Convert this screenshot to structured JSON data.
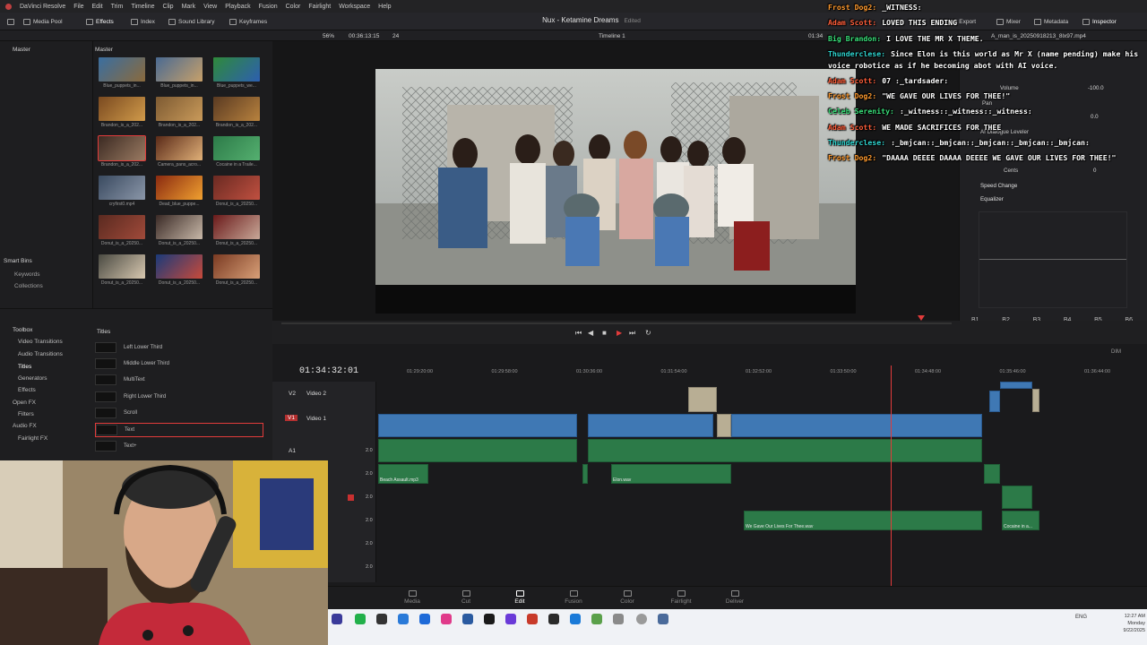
{
  "app": {
    "name": "DaVinci Resolve",
    "menu": [
      "File",
      "Edit",
      "Trim",
      "Timeline",
      "Clip",
      "Mark",
      "View",
      "Playback",
      "Fusion",
      "Color",
      "Fairlight",
      "Workspace",
      "Help"
    ],
    "project_title": "Nux - Ketamine Dreams",
    "project_state": "Edited"
  },
  "toolbar": {
    "media_pool": "Media Pool",
    "effects": "Effects",
    "index": "Index",
    "sound_library": "Sound Library",
    "keyframes": "Keyframes",
    "quick_export": "ck Export",
    "mixer": "Mixer",
    "metadata": "Metadata",
    "inspector": "Inspector"
  },
  "subbar": {
    "zoom": "56%",
    "timecode": "00:36:13:15",
    "frames": "24",
    "timeline_name": "Timeline 1",
    "viewer_tc": "01:34",
    "clip_file": "A_man_is_20250918213_8lx97.mp4"
  },
  "bins": {
    "master_left": "Master",
    "master_right": "Master",
    "smart_bins": "Smart Bins",
    "keywords": "Keywords",
    "collections": "Collections"
  },
  "thumbs": [
    {
      "label": "Blue_puppets_in...",
      "c1": "#3a6ea0",
      "c2": "#8a6a3c"
    },
    {
      "label": "Blue_puppets_in...",
      "c1": "#4a6a92",
      "c2": "#c7a06a"
    },
    {
      "label": "Blue_puppets_we...",
      "c1": "#2f8a3a",
      "c2": "#2d5fb0"
    },
    {
      "label": "Brandon_is_a_202...",
      "c1": "#7a4a20",
      "c2": "#d09a4a"
    },
    {
      "label": "Brandon_is_a_202...",
      "c1": "#7d5a32",
      "c2": "#c99a5a"
    },
    {
      "label": "Brandon_is_a_202...",
      "c1": "#5a3a22",
      "c2": "#b8823e"
    },
    {
      "label": "Brandon_is_a_202...",
      "c1": "#3b2a22",
      "c2": "#9a7a62"
    },
    {
      "label": "Camera_pans_acro...",
      "c1": "#5a2a18",
      "c2": "#e0b078"
    },
    {
      "label": "Cocaine in a Traile...",
      "c1": "#2c7a48",
      "c2": "#55b070"
    },
    {
      "label": "cryfirst0.mp4",
      "c1": "#3a4a60",
      "c2": "#8a96a8"
    },
    {
      "label": "Dead_blue_puppe...",
      "c1": "#8a2a10",
      "c2": "#f0a030"
    },
    {
      "label": "Donut_is_a_20250...",
      "c1": "#6a2a22",
      "c2": "#c05040"
    },
    {
      "label": "Donut_is_a_20250...",
      "c1": "#5a2a20",
      "c2": "#a04a3a"
    },
    {
      "label": "Donut_is_a_20250...",
      "c1": "#3a2a26",
      "c2": "#c8b8a8"
    },
    {
      "label": "Donut_is_a_20250...",
      "c1": "#6a1a1a",
      "c2": "#c8a898"
    },
    {
      "label": "Donut_is_a_20250...",
      "c1": "#4a4a42",
      "c2": "#d8c8b0"
    },
    {
      "label": "Donut_is_a_20250...",
      "c1": "#1a3a7a",
      "c2": "#c84a3a"
    },
    {
      "label": "Donut_is_a_20250...",
      "c1": "#7a3a22",
      "c2": "#d8a078"
    }
  ],
  "toolbox": {
    "items": [
      "Toolbox",
      "Video Transitions",
      "Audio Transitions",
      "Titles",
      "Generators",
      "Effects",
      "Open FX",
      "Filters",
      "Audio FX",
      "Fairlight FX"
    ],
    "header": "Titles",
    "titles": [
      "Left Lower Third",
      "Middle Lower Third",
      "MultiText",
      "Right Lower Third",
      "Scroll",
      "Text",
      "Text+"
    ]
  },
  "inspector": {
    "volume_label": "Volume",
    "volume_val": "-100.0",
    "pan_label": "Pan",
    "pan_val": "0.0",
    "dialogue": "AI Dialogue Leveler",
    "cents_label": "Cents",
    "cents_val": "0",
    "speed_change": "Speed Change",
    "equalizer": "Equalizer",
    "eq_bands": [
      "B1",
      "B2",
      "B3",
      "B4",
      "B5",
      "B6"
    ]
  },
  "timeline": {
    "timecode": "01:34:32:01",
    "ruler": [
      "01:29:20:00",
      "01:29:58:00",
      "01:30:36:00",
      "01:31:54:00",
      "01:32:52:00",
      "01:33:50:00",
      "01:34:48:00",
      "01:35:46:00",
      "01:36:44:00"
    ],
    "tracks": [
      {
        "id": "V2",
        "name": "Video 2"
      },
      {
        "id": "V1",
        "name": "Video 1"
      },
      {
        "id": "A1",
        "name": "",
        "level": "2.0"
      },
      {
        "id": "",
        "name": "",
        "level": "2.0"
      },
      {
        "id": "",
        "name": "",
        "level": "2.0"
      },
      {
        "id": "",
        "name": "",
        "level": "2.0"
      },
      {
        "id": "",
        "name": "",
        "level": "2.0"
      },
      {
        "id": "",
        "name": "",
        "level": "2.0"
      }
    ],
    "clip_labels": {
      "beach": "Beach Assault.mp3",
      "elon": "Elon.wav",
      "gave": "We Gave Our Lives For Thee.wav",
      "cocaine": "Cocaine in a..."
    },
    "dim_label": "DIM"
  },
  "pages": [
    "Media",
    "Cut",
    "Edit",
    "Fusion",
    "Color",
    "Fairlight",
    "Deliver"
  ],
  "active_page": "Edit",
  "chat": [
    {
      "user": "Frost Dog2:",
      "color": "#ff9a2e",
      "msg": "_WITNESS:"
    },
    {
      "user": "Adam Scott:",
      "color": "#ff5e3a",
      "msg": "LOVED THIS ENDING"
    },
    {
      "user": "Big Brandon:",
      "color": "#39e07a",
      "msg": "I LOVE THE MR X THEME."
    },
    {
      "user": "Thunderclese:",
      "color": "#2ed5d0",
      "msg": "Since Elon is this world as Mr X (name pending) make his voice robotice as if he becoming abot with AI voice."
    },
    {
      "user": "Adam Scott:",
      "color": "#ff5e3a",
      "msg": "07 :_tardsader:"
    },
    {
      "user": "Frost Dog2:",
      "color": "#ff9a2e",
      "msg": "\"WE GAVE OUR LIVES FOR THEE!\""
    },
    {
      "user": "Celeb Serenity:",
      "color": "#39e07a",
      "msg": ":_witness::_witness::_witness:"
    },
    {
      "user": "Adam Scott:",
      "color": "#ff5e3a",
      "msg": "WE MADE SACRIFICES FOR THEE"
    },
    {
      "user": "Thunderclese:",
      "color": "#2ed5d0",
      "msg": ":_bmjcan::_bmjcan::_bmjcan::_bmjcan::_bmjcan:"
    },
    {
      "user": "Frost Dog2:",
      "color": "#ff9a2e",
      "msg": "\"DAAAA DEEEE DAAAA DEEEE WE GAVE OUR LIVES FOR THEE!\""
    }
  ],
  "system": {
    "lang": "ENG",
    "time": "12:27 AM",
    "day": "Monday",
    "date": "9/22/2025"
  }
}
